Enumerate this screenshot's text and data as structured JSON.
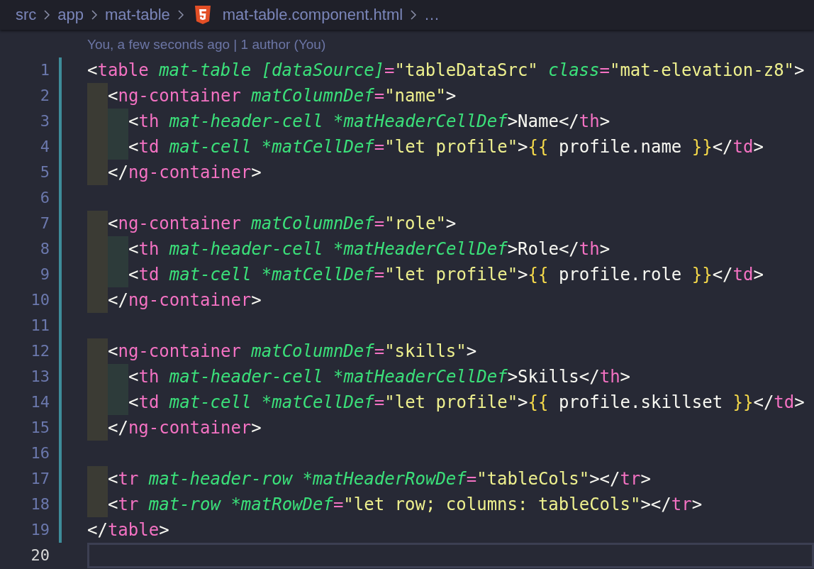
{
  "breadcrumbs": [
    {
      "kind": "folder",
      "label": "src"
    },
    {
      "kind": "folder",
      "label": "app"
    },
    {
      "kind": "folder",
      "label": "mat-table"
    },
    {
      "kind": "html-file",
      "label": "mat-table.component.html"
    },
    {
      "kind": "more",
      "label": "…"
    }
  ],
  "blame": "You, a few seconds ago | 1 author (You)",
  "lines": [
    {
      "number": "1",
      "modified": true,
      "active": false,
      "tokens": [
        {
          "kind": "punct",
          "text": "<"
        },
        {
          "kind": "tag",
          "text": "table"
        },
        {
          "kind": "attr",
          "text": " mat-table [dataSource]"
        },
        {
          "kind": "op",
          "text": "="
        },
        {
          "kind": "string",
          "text": "\"tableDataSrc\""
        },
        {
          "kind": "attr",
          "text": " class"
        },
        {
          "kind": "op",
          "text": "="
        },
        {
          "kind": "string",
          "text": "\"mat-elevation-z8\""
        },
        {
          "kind": "punct",
          "text": ">"
        }
      ],
      "children": [
        {
          "number": "2",
          "modified": true,
          "active": false,
          "tokens": [
            {
              "kind": "punct",
              "text": "<"
            },
            {
              "kind": "tag",
              "text": "ng-container"
            },
            {
              "kind": "attr",
              "text": " matColumnDef"
            },
            {
              "kind": "op",
              "text": "="
            },
            {
              "kind": "string",
              "text": "\"name\""
            },
            {
              "kind": "punct",
              "text": ">"
            }
          ],
          "children": [
            {
              "number": "3",
              "modified": true,
              "active": false,
              "tokens": [
                {
                  "kind": "punct",
                  "text": "<"
                },
                {
                  "kind": "tag",
                  "text": "th"
                },
                {
                  "kind": "attr",
                  "text": " mat-header-cell *matHeaderCellDef"
                },
                {
                  "kind": "punct",
                  "text": ">Name</"
                },
                {
                  "kind": "tag",
                  "text": "th"
                },
                {
                  "kind": "punct",
                  "text": ">"
                }
              ]
            },
            {
              "number": "4",
              "modified": true,
              "active": false,
              "tokens": [
                {
                  "kind": "punct",
                  "text": "<"
                },
                {
                  "kind": "tag",
                  "text": "td"
                },
                {
                  "kind": "attr",
                  "text": " mat-cell *matCellDef"
                },
                {
                  "kind": "op",
                  "text": "="
                },
                {
                  "kind": "string",
                  "text": "\"let profile\""
                },
                {
                  "kind": "punct",
                  "text": ">"
                },
                {
                  "kind": "brace",
                  "text": "{{"
                },
                {
                  "kind": "punct",
                  "text": " profile.name "
                },
                {
                  "kind": "brace",
                  "text": "}}"
                },
                {
                  "kind": "punct",
                  "text": "</"
                },
                {
                  "kind": "tag",
                  "text": "td"
                },
                {
                  "kind": "punct",
                  "text": ">"
                }
              ]
            }
          ]
        },
        {
          "number": "5",
          "modified": true,
          "active": false,
          "tokens": [
            {
              "kind": "punct",
              "text": "</"
            },
            {
              "kind": "tag",
              "text": "ng-container"
            },
            {
              "kind": "punct",
              "text": ">"
            }
          ]
        },
        {
          "number": "6",
          "modified": true,
          "active": false
        },
        {
          "number": "7",
          "modified": true,
          "active": false,
          "tokens": [
            {
              "kind": "punct",
              "text": "<"
            },
            {
              "kind": "tag",
              "text": "ng-container"
            },
            {
              "kind": "attr",
              "text": " matColumnDef"
            },
            {
              "kind": "op",
              "text": "="
            },
            {
              "kind": "string",
              "text": "\"role\""
            },
            {
              "kind": "punct",
              "text": ">"
            }
          ],
          "children": [
            {
              "number": "8",
              "modified": true,
              "active": false,
              "tokens": [
                {
                  "kind": "punct",
                  "text": "<"
                },
                {
                  "kind": "tag",
                  "text": "th"
                },
                {
                  "kind": "attr",
                  "text": " mat-header-cell *matHeaderCellDef"
                },
                {
                  "kind": "punct",
                  "text": ">Role</"
                },
                {
                  "kind": "tag",
                  "text": "th"
                },
                {
                  "kind": "punct",
                  "text": ">"
                }
              ]
            },
            {
              "number": "9",
              "modified": true,
              "active": false,
              "tokens": [
                {
                  "kind": "punct",
                  "text": "<"
                },
                {
                  "kind": "tag",
                  "text": "td"
                },
                {
                  "kind": "attr",
                  "text": " mat-cell *matCellDef"
                },
                {
                  "kind": "op",
                  "text": "="
                },
                {
                  "kind": "string",
                  "text": "\"let profile\""
                },
                {
                  "kind": "punct",
                  "text": ">"
                },
                {
                  "kind": "brace",
                  "text": "{{"
                },
                {
                  "kind": "punct",
                  "text": " profile.role "
                },
                {
                  "kind": "brace",
                  "text": "}}"
                },
                {
                  "kind": "punct",
                  "text": "</"
                },
                {
                  "kind": "tag",
                  "text": "td"
                },
                {
                  "kind": "punct",
                  "text": ">"
                }
              ]
            }
          ]
        },
        {
          "number": "10",
          "modified": true,
          "active": false,
          "tokens": [
            {
              "kind": "punct",
              "text": "</"
            },
            {
              "kind": "tag",
              "text": "ng-container"
            },
            {
              "kind": "punct",
              "text": ">"
            }
          ]
        },
        {
          "number": "11",
          "modified": true,
          "active": false
        },
        {
          "number": "12",
          "modified": true,
          "active": false,
          "tokens": [
            {
              "kind": "punct",
              "text": "<"
            },
            {
              "kind": "tag",
              "text": "ng-container"
            },
            {
              "kind": "attr",
              "text": " matColumnDef"
            },
            {
              "kind": "op",
              "text": "="
            },
            {
              "kind": "string",
              "text": "\"skills\""
            },
            {
              "kind": "punct",
              "text": ">"
            }
          ],
          "children": [
            {
              "number": "13",
              "modified": true,
              "active": false,
              "tokens": [
                {
                  "kind": "punct",
                  "text": "<"
                },
                {
                  "kind": "tag",
                  "text": "th"
                },
                {
                  "kind": "attr",
                  "text": " mat-header-cell *matHeaderCellDef"
                },
                {
                  "kind": "punct",
                  "text": ">Skills</"
                },
                {
                  "kind": "tag",
                  "text": "th"
                },
                {
                  "kind": "punct",
                  "text": ">"
                }
              ]
            },
            {
              "number": "14",
              "modified": true,
              "active": false,
              "tokens": [
                {
                  "kind": "punct",
                  "text": "<"
                },
                {
                  "kind": "tag",
                  "text": "td"
                },
                {
                  "kind": "attr",
                  "text": " mat-cell *matCellDef"
                },
                {
                  "kind": "op",
                  "text": "="
                },
                {
                  "kind": "string",
                  "text": "\"let profile\""
                },
                {
                  "kind": "punct",
                  "text": ">"
                },
                {
                  "kind": "brace",
                  "text": "{{"
                },
                {
                  "kind": "punct",
                  "text": " profile.skillset "
                },
                {
                  "kind": "brace",
                  "text": "}}"
                },
                {
                  "kind": "punct",
                  "text": "</"
                },
                {
                  "kind": "tag",
                  "text": "td"
                },
                {
                  "kind": "punct",
                  "text": ">"
                }
              ]
            }
          ]
        },
        {
          "number": "15",
          "modified": true,
          "active": false,
          "tokens": [
            {
              "kind": "punct",
              "text": "</"
            },
            {
              "kind": "tag",
              "text": "ng-container"
            },
            {
              "kind": "punct",
              "text": ">"
            }
          ]
        },
        {
          "number": "16",
          "modified": true,
          "active": false
        },
        {
          "number": "17",
          "modified": true,
          "active": false,
          "tokens": [
            {
              "kind": "punct",
              "text": "<"
            },
            {
              "kind": "tag",
              "text": "tr"
            },
            {
              "kind": "attr",
              "text": " mat-header-row *matHeaderRowDef"
            },
            {
              "kind": "op",
              "text": "="
            },
            {
              "kind": "string",
              "text": "\"tableCols\""
            },
            {
              "kind": "punct",
              "text": "></"
            },
            {
              "kind": "tag",
              "text": "tr"
            },
            {
              "kind": "punct",
              "text": ">"
            }
          ]
        },
        {
          "number": "18",
          "modified": true,
          "active": false,
          "tokens": [
            {
              "kind": "punct",
              "text": "<"
            },
            {
              "kind": "tag",
              "text": "tr"
            },
            {
              "kind": "attr",
              "text": " mat-row *matRowDef"
            },
            {
              "kind": "op",
              "text": "="
            },
            {
              "kind": "string",
              "text": "\"let row; columns: tableCols\""
            },
            {
              "kind": "punct",
              "text": "></"
            },
            {
              "kind": "tag",
              "text": "tr"
            },
            {
              "kind": "punct",
              "text": ">"
            }
          ]
        }
      ]
    },
    {
      "number": "19",
      "modified": true,
      "active": false,
      "tokens": [
        {
          "kind": "punct",
          "text": "</"
        },
        {
          "kind": "tag",
          "text": "table"
        },
        {
          "kind": "punct",
          "text": ">"
        }
      ]
    },
    {
      "number": "20",
      "modified": false,
      "active": true
    }
  ]
}
